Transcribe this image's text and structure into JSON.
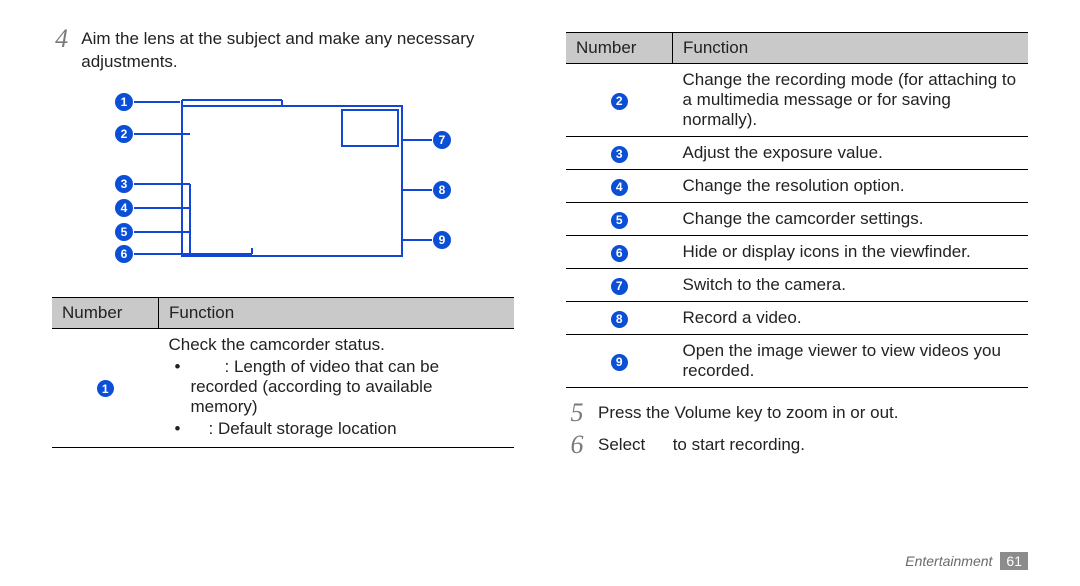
{
  "left": {
    "step4_num": "4",
    "step4_text": "Aim the lens at the subject and make any necessary adjustments.",
    "diagram_callouts_left": [
      "1",
      "2",
      "3",
      "4",
      "5",
      "6"
    ],
    "diagram_callouts_right": [
      "7",
      "8",
      "9"
    ],
    "table_head_num": "Number",
    "table_head_func": "Function",
    "row1_num": "1",
    "row1_line1": "Check the camcorder status.",
    "row1_bullet1_lead": "",
    "row1_bullet1_rest": ": Length of video that can be recorded (according to available memory)",
    "row1_bullet2_lead": "",
    "row1_bullet2_rest": ": Default storage location"
  },
  "right": {
    "table_head_num": "Number",
    "table_head_func": "Function",
    "rows": [
      {
        "n": "2",
        "f": "Change the recording mode (for attaching to a multimedia message or for saving normally)."
      },
      {
        "n": "3",
        "f": "Adjust the exposure value."
      },
      {
        "n": "4",
        "f": "Change the resolution option."
      },
      {
        "n": "5",
        "f": "Change the camcorder settings."
      },
      {
        "n": "6",
        "f": "Hide or display icons in the viewfinder."
      },
      {
        "n": "7",
        "f": "Switch to the camera."
      },
      {
        "n": "8",
        "f": "Record a video."
      },
      {
        "n": "9",
        "f": "Open the image viewer to view videos you recorded."
      }
    ],
    "step5_num": "5",
    "step5_text": "Press the Volume key to zoom in or out.",
    "step6_num": "6",
    "step6_text_a": "Select ",
    "step6_text_b": " to start recording."
  },
  "footer": {
    "section": "Entertainment",
    "page": "61"
  }
}
